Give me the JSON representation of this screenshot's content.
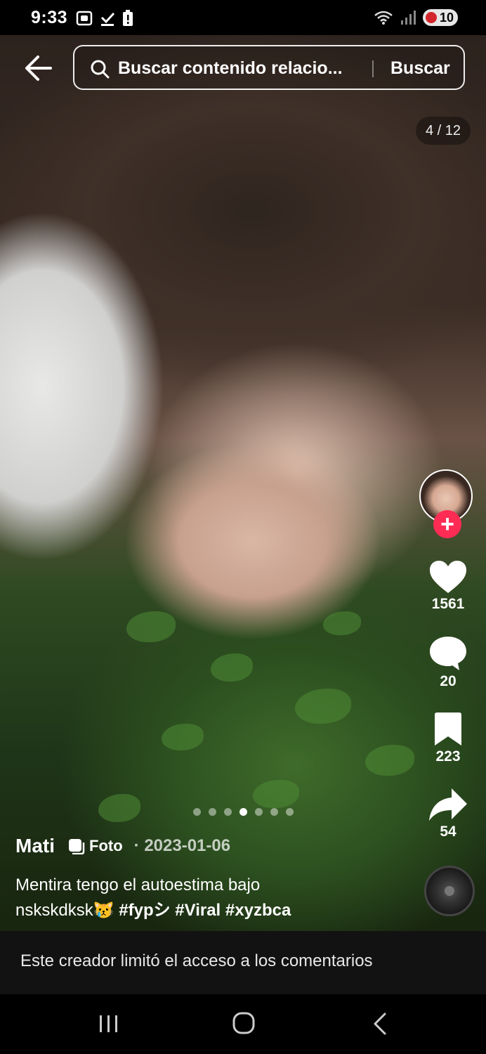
{
  "status_bar": {
    "time": "9:33",
    "battery_level": "10",
    "icons_left": [
      "screen-record-icon",
      "download-check-icon",
      "battery-alert-icon"
    ],
    "icons_right": [
      "wifi-icon",
      "signal-icon",
      "battery-icon"
    ]
  },
  "search": {
    "text": "Buscar contenido relacio...",
    "button_label": "Buscar"
  },
  "page_counter": "4 / 12",
  "carousel": {
    "total_dots": 7,
    "active_index": 3
  },
  "actions": {
    "likes": "1561",
    "comments": "20",
    "saves": "223",
    "shares": "54"
  },
  "post": {
    "author": "Mati",
    "type_label": "Foto",
    "date": "· 2023-01-06",
    "caption_line1": "Mentira tengo el autoestima bajo",
    "caption_text2": "nskskdksk😿 ",
    "hashtags": [
      "#fypシ",
      "#Viral",
      "#xyzbca"
    ]
  },
  "comments_notice": "Este creador limitó el acceso a los comentarios",
  "colors": {
    "accent": "#fe2c55",
    "bar_bg": "#121212"
  }
}
